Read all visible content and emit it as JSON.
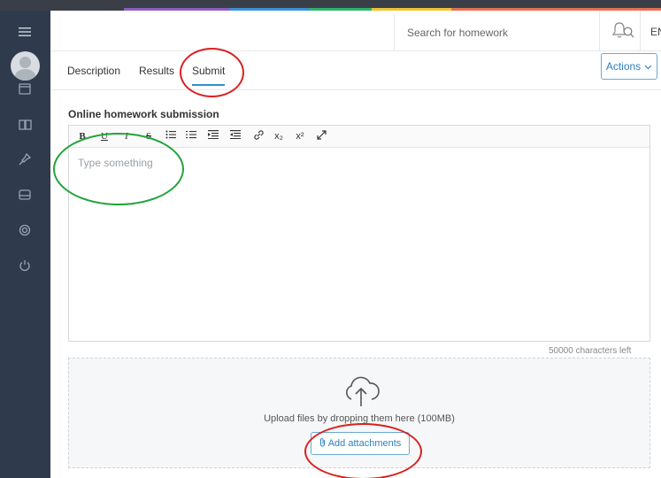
{
  "header": {
    "search": {
      "placeholder": "Search for homework"
    },
    "language": "EN ▾"
  },
  "tabs": [
    {
      "label": "Description"
    },
    {
      "label": "Results"
    },
    {
      "label": "Submit",
      "active": true
    }
  ],
  "actions_label": "Actions",
  "submission": {
    "title": "Online homework submission",
    "toolbar": [
      "B",
      "U",
      "I",
      "S",
      "ul",
      "ol",
      "outdent",
      "indent",
      "link",
      "x₂",
      "x²",
      "fullscreen"
    ],
    "editor_placeholder": "Type something",
    "chars_left": "50000 characters left"
  },
  "upload": {
    "drop_text": "Upload files by dropping them here (100MB)",
    "button_label": "Add attachments"
  },
  "colors": {
    "sidebar": "#2f3b4c",
    "accent": "#2d91d0",
    "annotation_red": "#d9211f",
    "annotation_green": "#21a33a"
  },
  "icons": {
    "sidebar": [
      "menu-icon",
      "calendar-icon",
      "book-icon",
      "pin-icon",
      "inbox-icon",
      "lifebuoy-icon",
      "power-icon"
    ],
    "header": [
      "search-icon",
      "bell-icon"
    ],
    "upload": "cloud-upload-icon",
    "attach": "paperclip-icon"
  }
}
